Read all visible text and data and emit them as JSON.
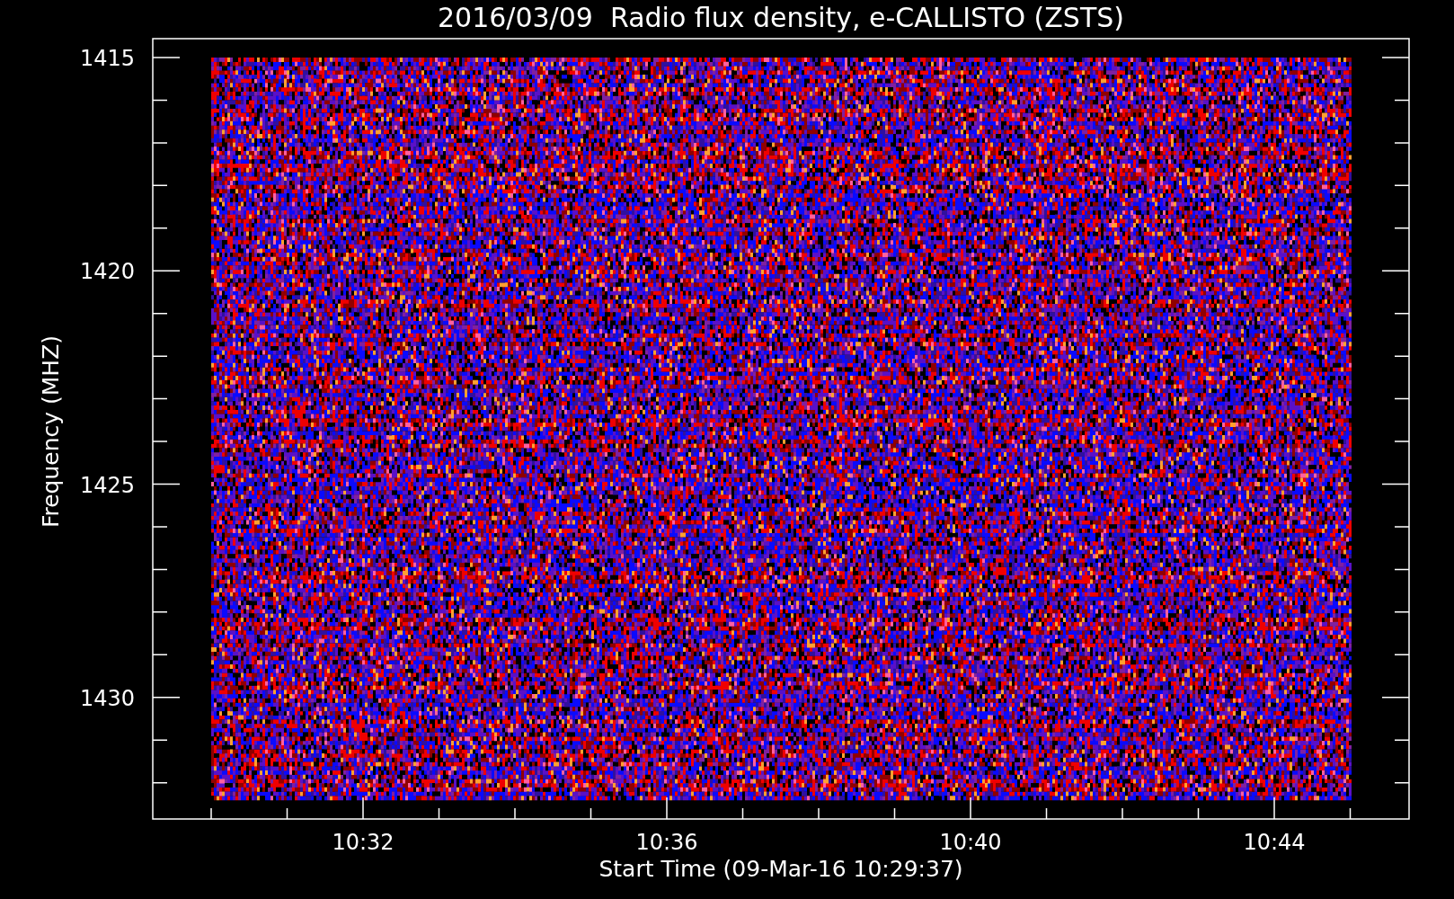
{
  "title": "2016/03/09  Radio flux density, e-CALLISTO (ZSTS)",
  "y_axis": {
    "label": "Frequency (MHZ)",
    "ticks": [
      "1415",
      "1420",
      "1425",
      "1430"
    ]
  },
  "x_axis": {
    "label": "Start Time (09-Mar-16 10:29:37)",
    "ticks": [
      "10:32",
      "10:36",
      "10:40",
      "10:44"
    ]
  }
}
